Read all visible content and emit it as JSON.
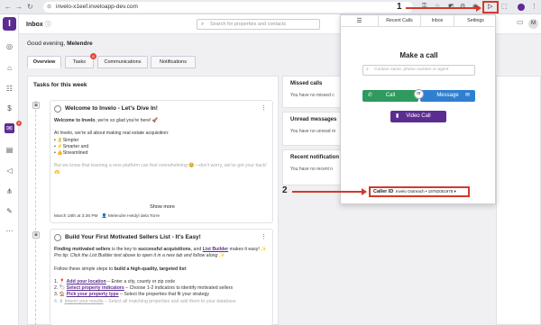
{
  "browser": {
    "url": "invelo-x1eef.inveloapp-dev.com",
    "nav": [
      "←",
      "→",
      "↻"
    ]
  },
  "sidebar": {
    "logo": "I",
    "badge": "5"
  },
  "topbar": {
    "title": "Inbox",
    "info": "ⓘ",
    "search_placeholder": "Search for properties and contacts",
    "avatar": "M"
  },
  "greeting": {
    "prefix": "Good evening, ",
    "name": "Melendre"
  },
  "tabs": [
    {
      "label": "Overview"
    },
    {
      "label": "Tasks",
      "badge": "6"
    },
    {
      "label": "Communications"
    },
    {
      "label": "Notifications"
    }
  ],
  "tasks_panel": {
    "title": "Tasks for this week"
  },
  "card1": {
    "title": "Welcome to Invelo - Let's Dive In!",
    "intro_b": "Welcome to Invelo",
    "intro_rest": ", we're so glad you're here! 🚀",
    "line2": "At Invelo, we're all about making real estate acquisition:",
    "bullets": [
      "👌Simpler",
      "⚡Smarter and",
      "👍Streamlined"
    ],
    "faded": "But we know that learning a new platform can feel overwhelming 😊—don't worry, we've got your back! 🫶",
    "show_more": "Show more",
    "date": "March 18th at 3:36 PM",
    "author": "Melendre Heidyl dela Torre"
  },
  "card2": {
    "title": "Build Your First Motivated Sellers List - It's Easy!",
    "p1_b": "Finding motivated sellers",
    "p1_mid": " is the key to ",
    "p1_b2": "successful acquisitions",
    "p1_and": ", and ",
    "p1_link": "List Builder",
    "p1_end": " makes it easy! ✨",
    "p1_tip": "Pro tip: Click the List Builder text above to open it in a new tab and follow along ✨",
    "p2_pre": "Follow these simple steps to ",
    "p2_b": "build a high-quality, targeted list",
    "p2_end": ":",
    "steps": [
      {
        "n": "1.",
        "link": "Add your location",
        "rest": " – Enter a city, county or zip code"
      },
      {
        "n": "2.",
        "link": "Select property indicators",
        "rest": " – Choose 1-2 indicators to identify motivated sellers"
      },
      {
        "n": "3.",
        "link": "Pick your property type",
        "rest": " – Select the properties that fit your strategy"
      },
      {
        "n": "4.",
        "link": "Import your results",
        "rest": " – Select all matching properties and add them to your database"
      }
    ]
  },
  "right_panels": [
    {
      "title": "Missed calls",
      "text": "You have no missed c"
    },
    {
      "title": "Unread messages",
      "text": "You have no unread m"
    },
    {
      "title": "Recent notification",
      "text": "You have no recent n"
    }
  ],
  "modal": {
    "tabs": [
      "☰",
      "Recent Calls",
      "Inbox",
      "Settings"
    ],
    "heading": "Make a call",
    "input_placeholder": "Contact name, phone number or agent",
    "call": "Call",
    "or": "or",
    "message": "Message",
    "video": "Video Call",
    "caller_id_label": "Caller ID",
    "caller_id_value": "Invelo Outreach • 19782051978"
  },
  "annotations": {
    "n1": "1",
    "n2": "2"
  },
  "colors": {
    "brand": "#5c2d91",
    "call_green": "#2e9a5e",
    "message_blue": "#2f7fd1",
    "annotation_red": "#d23a2b"
  }
}
